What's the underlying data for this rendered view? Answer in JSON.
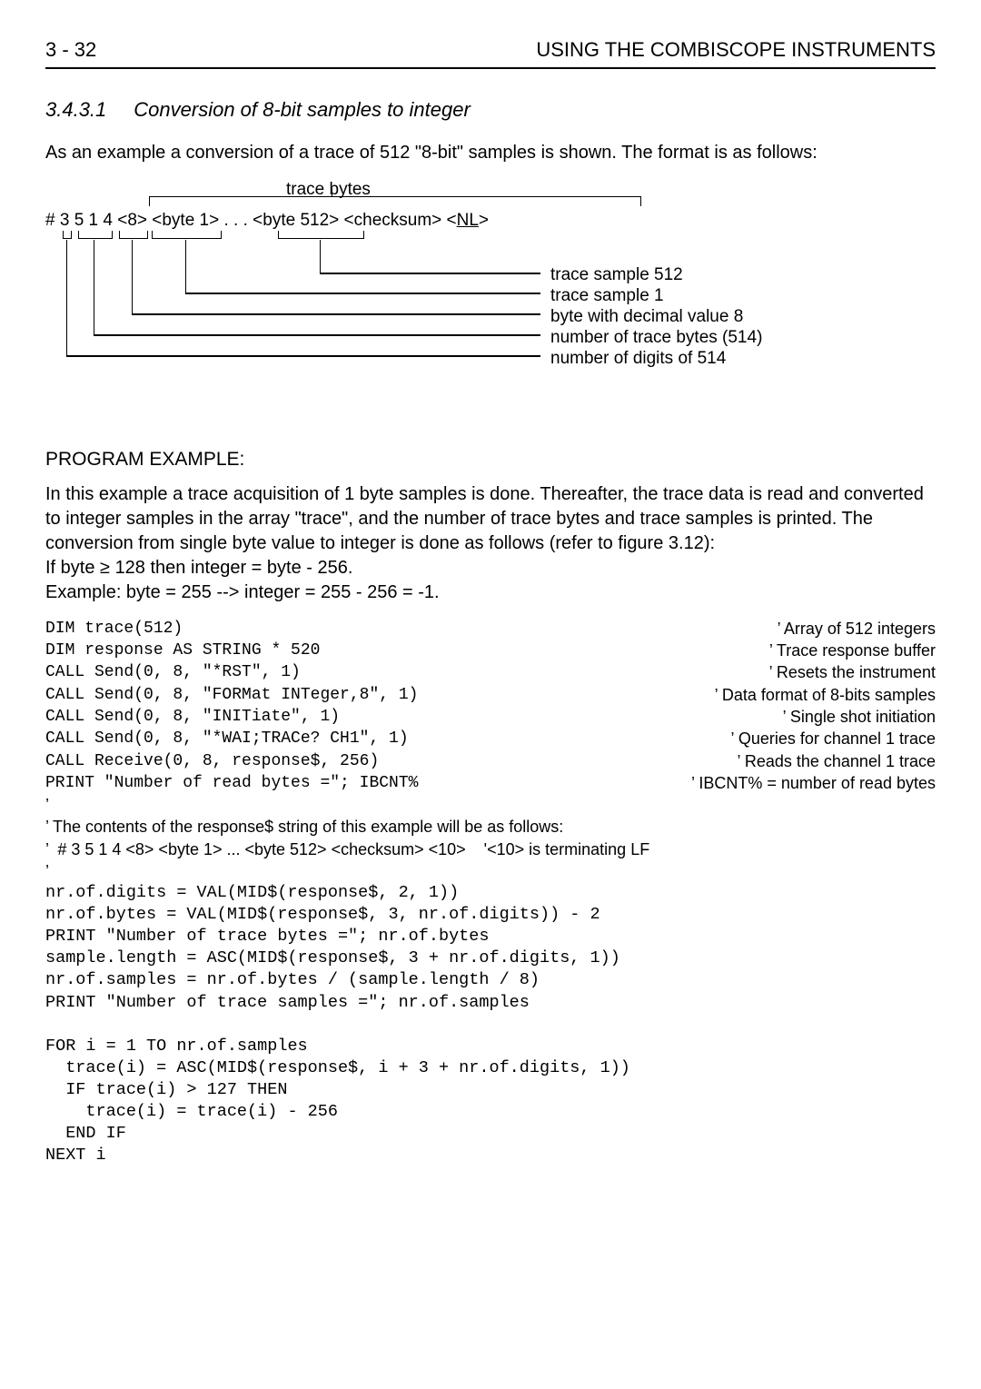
{
  "header": {
    "page_left": "3 - 32",
    "page_right": "USING THE COMBISCOPE INSTRUMENTS"
  },
  "section": {
    "num": "3.4.3.1",
    "title": "Conversion of 8-bit samples to integer"
  },
  "intro": "As an example a conversion of a trace of 512 \"8-bit\" samples is shown. The format is as follows:",
  "diagram": {
    "trace_label": "trace bytes",
    "byte_line_prefix": "# 3 5 1 4 <8> <byte 1> . . . <byte 512> <checksum> <",
    "byte_line_NL": "NL",
    "byte_line_suffix": ">",
    "labels": {
      "sample512": "trace sample 512",
      "sample1": "trace sample 1",
      "byte8": "byte with decimal value 8",
      "nbytes": "number of trace bytes (514)",
      "ndigits": "number of digits of 514"
    }
  },
  "program_example": "PROGRAM EXAMPLE:",
  "prog_intro1": "In this example a trace acquisition of 1 byte samples is done. Thereafter, the trace data is read and converted to integer samples in the array \"trace\", and the number of trace bytes and trace samples is printed. The conversion from single byte value to integer is done as follows (refer to figure 3.12):",
  "prog_intro2": "If byte ≥ 128 then integer = byte - 256.",
  "prog_intro3": "Example: byte = 255 --> integer = 255 - 256 = -1.",
  "code": {
    "l1": {
      "c": "DIM trace(512)",
      "m": "’ Array of 512 integers"
    },
    "l2": {
      "c": "DIM response AS STRING * 520",
      "m": "’ Trace response buffer"
    },
    "l3": {
      "c": "CALL Send(0, 8, \"*RST\", 1)",
      "m": "’ Resets the instrument"
    },
    "l4": {
      "c": "CALL Send(0, 8, \"FORMat INTeger,8\", 1)",
      "m": "’ Data format of 8-bits samples"
    },
    "l5": {
      "c": "CALL Send(0, 8, \"INITiate\", 1)",
      "m": "’ Single shot initiation"
    },
    "l6": {
      "c": "CALL Send(0, 8, \"*WAI;TRACe? CH1\", 1)",
      "m": "’ Queries for channel 1 trace"
    },
    "l7": {
      "c": "CALL Receive(0, 8, response$, 256)",
      "m": "’ Reads the channel 1 trace"
    },
    "l8": {
      "c": "PRINT \"Number of read bytes =\"; IBCNT%",
      "m": "’ IBCNT% = number of read bytes"
    },
    "l9": "’",
    "l10": "’ The contents of the response$ string of this example will be as follows:",
    "l11": "’  # 3 5 1 4 <8> <byte 1> ... <byte 512> <checksum> <10>    '<10> is terminating LF",
    "l12": "’",
    "rest": "nr.of.digits = VAL(MID$(response$, 2, 1))\nnr.of.bytes = VAL(MID$(response$, 3, nr.of.digits)) - 2\nPRINT \"Number of trace bytes =\"; nr.of.bytes\nsample.length = ASC(MID$(response$, 3 + nr.of.digits, 1))\nnr.of.samples = nr.of.bytes / (sample.length / 8)\nPRINT \"Number of trace samples =\"; nr.of.samples\n\nFOR i = 1 TO nr.of.samples\n  trace(i) = ASC(MID$(response$, i + 3 + nr.of.digits, 1))\n  IF trace(i) > 127 THEN\n    trace(i) = trace(i) - 256\n  END IF\nNEXT i"
  }
}
